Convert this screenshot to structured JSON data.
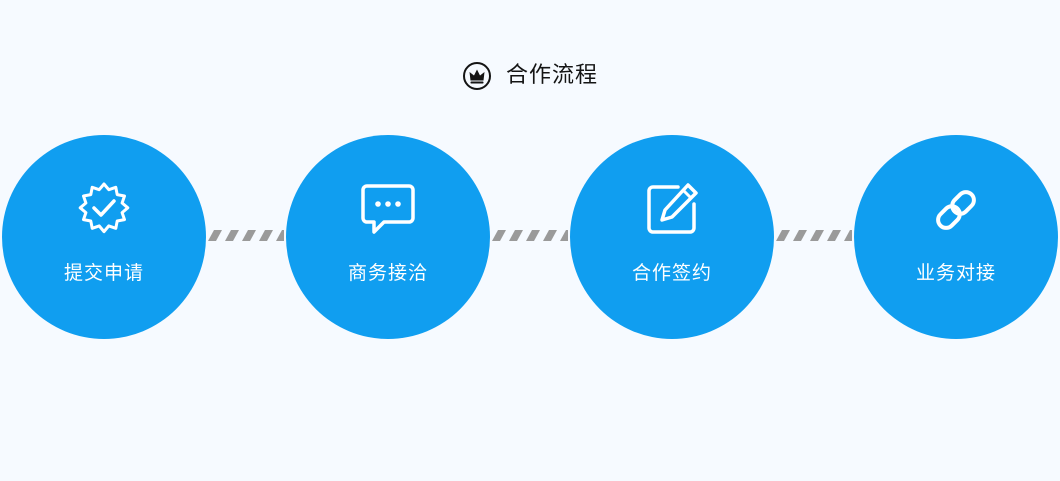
{
  "header": {
    "title": "合作流程",
    "icon": "crown-icon"
  },
  "steps": [
    {
      "label": "提交申请",
      "icon": "verified-badge-icon"
    },
    {
      "label": "商务接洽",
      "icon": "chat-bubble-icon"
    },
    {
      "label": "合作签约",
      "icon": "edit-pen-icon"
    },
    {
      "label": "业务对接",
      "icon": "link-icon"
    }
  ],
  "colors": {
    "background": "#f6faff",
    "step_circle": "#109ef0",
    "connector": "#9a9a9a",
    "title_text": "#141414"
  }
}
